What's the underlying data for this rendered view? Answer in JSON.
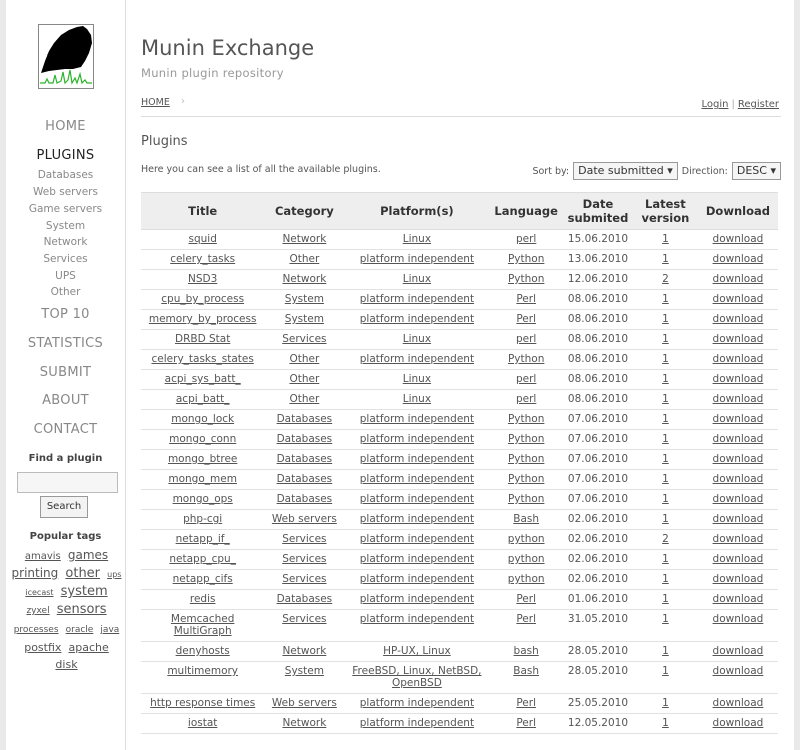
{
  "sidebar": {
    "logo_name": "munin-logo",
    "nav": {
      "home": "HOME",
      "plugins": "PLUGINS",
      "sub": [
        "Databases",
        "Web servers",
        "Game servers",
        "System",
        "Network",
        "Services",
        "UPS",
        "Other"
      ],
      "top10": "TOP 10",
      "statistics": "STATISTICS",
      "submit": "SUBMIT",
      "about": "ABOUT",
      "contact": "CONTACT"
    },
    "find_title": "Find a plugin",
    "search_value": "",
    "search_button": "Search",
    "tags_title": "Popular tags",
    "tags": [
      {
        "text": "amavis",
        "size": 10
      },
      {
        "text": "games",
        "size": 12
      },
      {
        "text": "printing",
        "size": 12
      },
      {
        "text": "other",
        "size": 13
      },
      {
        "text": "ups",
        "size": 8
      },
      {
        "text": "icecast",
        "size": 8
      },
      {
        "text": "system",
        "size": 13
      },
      {
        "text": "zyxel",
        "size": 9
      },
      {
        "text": "sensors",
        "size": 13
      },
      {
        "text": "processes",
        "size": 9
      },
      {
        "text": "oracle",
        "size": 9
      },
      {
        "text": "java",
        "size": 9
      },
      {
        "text": "postfix",
        "size": 11
      },
      {
        "text": "apache",
        "size": 11
      },
      {
        "text": "disk",
        "size": 11
      }
    ]
  },
  "header": {
    "title": "Munin Exchange",
    "subtitle": "Munin plugin repository",
    "breadcrumb": "HOME",
    "login": "Login",
    "separator": "|",
    "register": "Register"
  },
  "plugins": {
    "heading": "Plugins",
    "intro": "Here you can see a list of all the available plugins.",
    "sort_label": "Sort by:",
    "sort_value": "Date submitted ▾",
    "direction_label": "Direction:",
    "direction_value": "DESC ▾",
    "columns": [
      "Title",
      "Category",
      "Platform(s)",
      "Language",
      "Date submited",
      "Latest version",
      "Download"
    ],
    "rows": [
      [
        "squid",
        "Network",
        "Linux",
        "perl",
        "15.06.2010",
        "1",
        "download"
      ],
      [
        "celery_tasks",
        "Other",
        "platform independent",
        "Python",
        "13.06.2010",
        "1",
        "download"
      ],
      [
        "NSD3",
        "Network",
        "Linux",
        "Python",
        "12.06.2010",
        "2",
        "download"
      ],
      [
        "cpu_by_process",
        "System",
        "platform independent",
        "Perl",
        "08.06.2010",
        "1",
        "download"
      ],
      [
        "memory_by_process",
        "System",
        "platform independent",
        "Perl",
        "08.06.2010",
        "1",
        "download"
      ],
      [
        "DRBD Stat",
        "Services",
        "Linux",
        "perl",
        "08.06.2010",
        "1",
        "download"
      ],
      [
        "celery_tasks_states",
        "Other",
        "platform independent",
        "Python",
        "08.06.2010",
        "1",
        "download"
      ],
      [
        "acpi_sys_batt_",
        "Other",
        "Linux",
        "perl",
        "08.06.2010",
        "1",
        "download"
      ],
      [
        "acpi_batt_",
        "Other",
        "Linux",
        "perl",
        "08.06.2010",
        "1",
        "download"
      ],
      [
        "mongo_lock",
        "Databases",
        "platform independent",
        "Python",
        "07.06.2010",
        "1",
        "download"
      ],
      [
        "mongo_conn",
        "Databases",
        "platform independent",
        "Python",
        "07.06.2010",
        "1",
        "download"
      ],
      [
        "mongo_btree",
        "Databases",
        "platform independent",
        "Python",
        "07.06.2010",
        "1",
        "download"
      ],
      [
        "mongo_mem",
        "Databases",
        "platform independent",
        "Python",
        "07.06.2010",
        "1",
        "download"
      ],
      [
        "mongo_ops",
        "Databases",
        "platform independent",
        "Python",
        "07.06.2010",
        "1",
        "download"
      ],
      [
        "php-cgi",
        "Web servers",
        "platform independent",
        "Bash",
        "02.06.2010",
        "1",
        "download"
      ],
      [
        "netapp_if_",
        "Services",
        "platform independent",
        "python",
        "02.06.2010",
        "2",
        "download"
      ],
      [
        "netapp_cpu_",
        "Services",
        "platform independent",
        "python",
        "02.06.2010",
        "1",
        "download"
      ],
      [
        "netapp_cifs",
        "Services",
        "platform independent",
        "python",
        "02.06.2010",
        "1",
        "download"
      ],
      [
        "redis",
        "Databases",
        "platform independent",
        "Perl",
        "01.06.2010",
        "1",
        "download"
      ],
      [
        "Memcached MultiGraph",
        "Services",
        "platform independent",
        "Perl",
        "31.05.2010",
        "1",
        "download"
      ],
      [
        "denyhosts",
        "Network",
        "HP-UX, Linux",
        "bash",
        "28.05.2010",
        "1",
        "download"
      ],
      [
        "multimemory",
        "System",
        "FreeBSD, Linux, NetBSD, OpenBSD",
        "Bash",
        "28.05.2010",
        "1",
        "download"
      ],
      [
        "http response times",
        "Web servers",
        "platform independent",
        "Perl",
        "25.05.2010",
        "1",
        "download"
      ],
      [
        "iostat",
        "Network",
        "platform independent",
        "Perl",
        "12.05.2010",
        "1",
        "download"
      ]
    ]
  }
}
